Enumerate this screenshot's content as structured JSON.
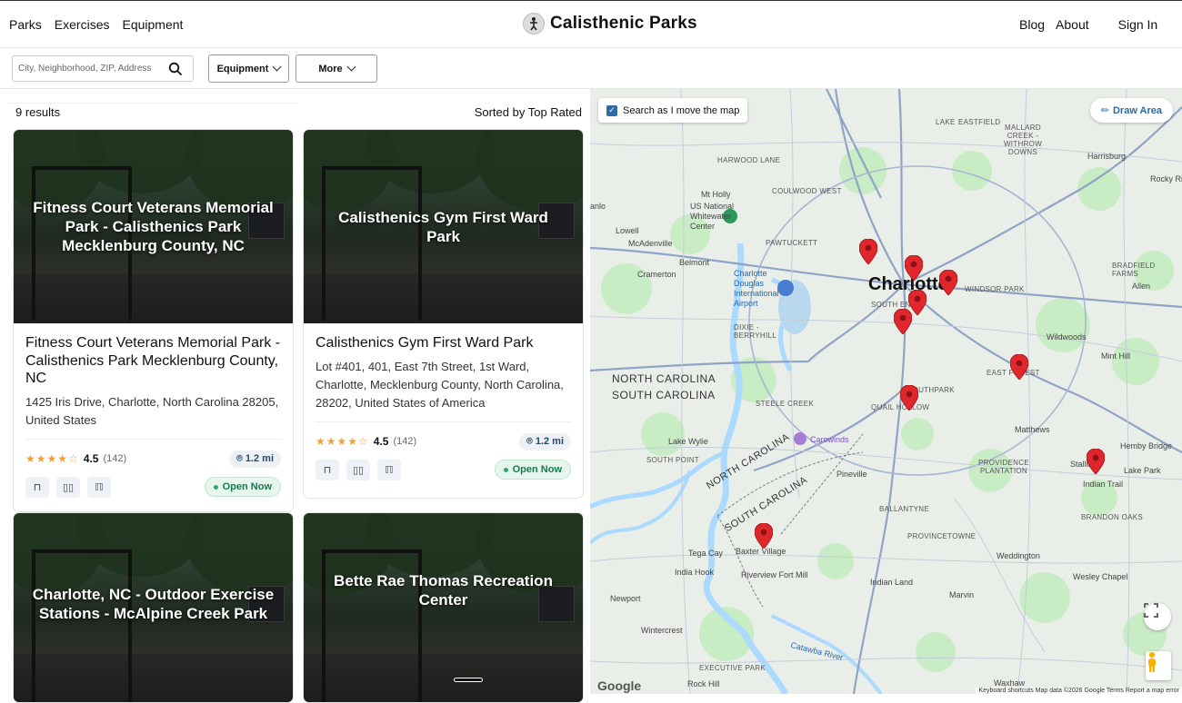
{
  "header": {
    "nav_left": [
      "Parks",
      "Exercises",
      "Equipment"
    ],
    "brand": "Calisthenic Parks",
    "nav_right": [
      "Blog",
      "About"
    ],
    "sign_in": "Sign In"
  },
  "filters": {
    "search_placeholder": "City, Neighborhood, ZIP, Address",
    "equipment_label": "Equipment",
    "more_label": "More"
  },
  "results": {
    "count": "9 results",
    "sort": "Sorted by Top Rated"
  },
  "cards": [
    {
      "overlay": "Fitness Court Veterans Memorial Park - Calisthenics Park Mecklenburg County, NC",
      "name": "Fitness Court Veterans Memorial Park - Calisthenics Park Mecklenburg County, NC",
      "address": "1425 Iris Drive, Charlotte, North Carolina 28205, United States",
      "stars": "★★★★☆",
      "score": "4.5",
      "reviews": "(142)",
      "distance": "1.2 mi",
      "status": "Open Now"
    },
    {
      "overlay": "Calisthenics Gym First Ward Park",
      "name": "Calisthenics Gym First Ward Park",
      "address": "Lot #401, 401, East 7th Street, 1st Ward, Charlotte, Mecklenburg County, North Carolina, 28202, United States of America",
      "stars": "★★★★☆",
      "score": "4.5",
      "reviews": "(142)",
      "distance": "1.2 mi",
      "status": "Open Now"
    },
    {
      "overlay": "Charlotte, NC - Outdoor Exercise Stations - McAlpine Creek Park"
    },
    {
      "overlay": "Bette Rae Thomas Recreation Center"
    }
  ],
  "map": {
    "search_as_move": "Search as I move the map",
    "draw_area": "Draw Area",
    "google": "Google",
    "attribution": "Keyboard shortcuts   Map data ©2026 Google   Terms   Report a map error",
    "city": "Charlotte",
    "labels": {
      "harwood": "HARWOOD LANE",
      "mtholly": "Mt Holly",
      "coulwood": "COULWOOD WEST",
      "uswhite": "US National Whitewater Center",
      "lowell": "Lowell",
      "mcadenville": "McAdenville",
      "belmont": "Belmont",
      "pawtucket": "PAWTUCKETT",
      "cramerton": "Cramerton",
      "airport": "Charlotte Douglas International Airport",
      "dixie": "DIXIE - BERRYHILL",
      "southend": "SOUTH END",
      "windsor": "WINDSOR PARK",
      "allen": "Allen",
      "wildwoods": "Wildwoods",
      "minthill": "Mint Hill",
      "eastforest": "EAST FOREST",
      "southpark": "SOUTHPARK",
      "quailhollow": "QUAIL HOLLOW",
      "nc": "NORTH CAROLINA",
      "sc": "SOUTH CAROLINA",
      "steelecreek": "STEELE CREEK",
      "lakewylie": "Lake Wylie",
      "carowinds": "Carowinds",
      "matthews": "Matthews",
      "hemby": "Hemby Bridge",
      "southpoint": "SOUTH POINT",
      "pineville": "Pineville",
      "provplant": "PROVIDENCE PLANTATION",
      "stallings": "Stallings",
      "lakepark": "Lake Park",
      "indiantrail": "Indian Trail",
      "ncdiag": "NORTH CAROLINA",
      "scdiag": "SOUTH CAROLINA",
      "ballantyne": "BALLANTYNE",
      "provcommons": "PROVINCETOWNE",
      "brandon": "BRANDON OAKS",
      "tegacay": "Tega Cay",
      "baxter": "Baxter Village",
      "indiahook": "India Hook",
      "riverview": "Riverview Fort Mill",
      "weddington": "Weddington",
      "wesley": "Wesley Chapel",
      "newport": "Newport",
      "indianland": "Indian Land",
      "marvin": "Marvin",
      "wintercrest": "Wintercrest",
      "catawba": "Catawba River",
      "rockhill": "Rock Hill",
      "exec": "EXECUTIVE PARK",
      "waxhaw": "Waxhaw",
      "harrisburg": "Harrisburg",
      "rockyriver": "Rocky Rive",
      "bradfield": "BRADFIELD FARMS",
      "eastfield": "EASTFIELD",
      "mallard": "MALLARD CREEK - WITHROW DOWNS",
      "lakeeast": "LAKE",
      "anlo": "anlo"
    }
  },
  "colors": {
    "accent": "#2b6aa3",
    "open": "#177a4e",
    "star": "#f0a13a",
    "pin": "#e0282c",
    "water": "#aadaff",
    "park": "#c8ecc4"
  }
}
